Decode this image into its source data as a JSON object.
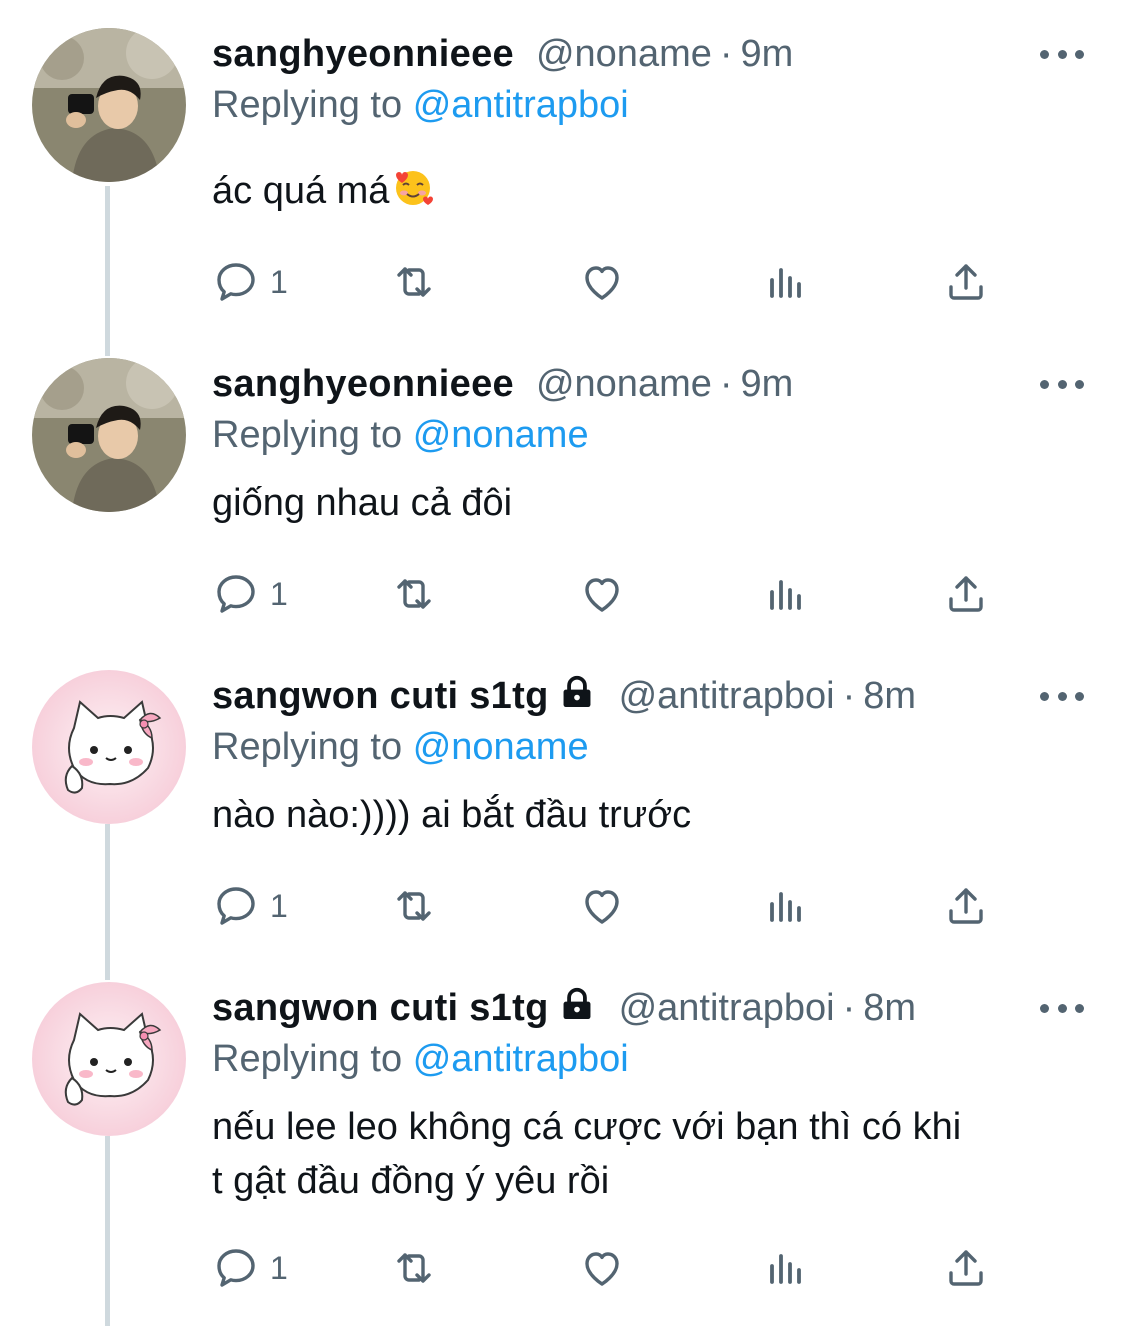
{
  "tweets": [
    {
      "name": "sanghyeonnieee",
      "handle": "@noname",
      "separator": "·",
      "time": "9m",
      "locked": false,
      "replying_prefix": "Replying to",
      "replying_to": "@antitrapboi",
      "text": "ác quá má",
      "emoji": "smiling-face-with-hearts",
      "reply_count": "1"
    },
    {
      "name": "sanghyeonnieee",
      "handle": "@noname",
      "separator": "·",
      "time": "9m",
      "locked": false,
      "replying_prefix": "Replying to",
      "replying_to": "@noname",
      "text": "giống nhau cả đôi",
      "reply_count": "1"
    },
    {
      "name": "sangwon cuti s1tg",
      "handle": "@antitrapboi",
      "separator": "·",
      "time": "8m",
      "locked": true,
      "replying_prefix": "Replying to",
      "replying_to": "@noname",
      "text": "nào nào:)))) ai bắt đầu trước",
      "reply_count": "1"
    },
    {
      "name": "sangwon cuti s1tg",
      "handle": "@antitrapboi",
      "separator": "·",
      "time": "8m",
      "locked": true,
      "replying_prefix": "Replying to",
      "replying_to": "@antitrapboi",
      "text_line1": "nếu lee leo không cá cược với bạn thì có khi",
      "text_line2": "t gật đầu đồng ý yêu rồi",
      "reply_count": "1"
    }
  ],
  "colors": {
    "text": "#0f1419",
    "secondary": "#536471",
    "link": "#1d9bf0",
    "thread_line": "#cfd9de"
  }
}
